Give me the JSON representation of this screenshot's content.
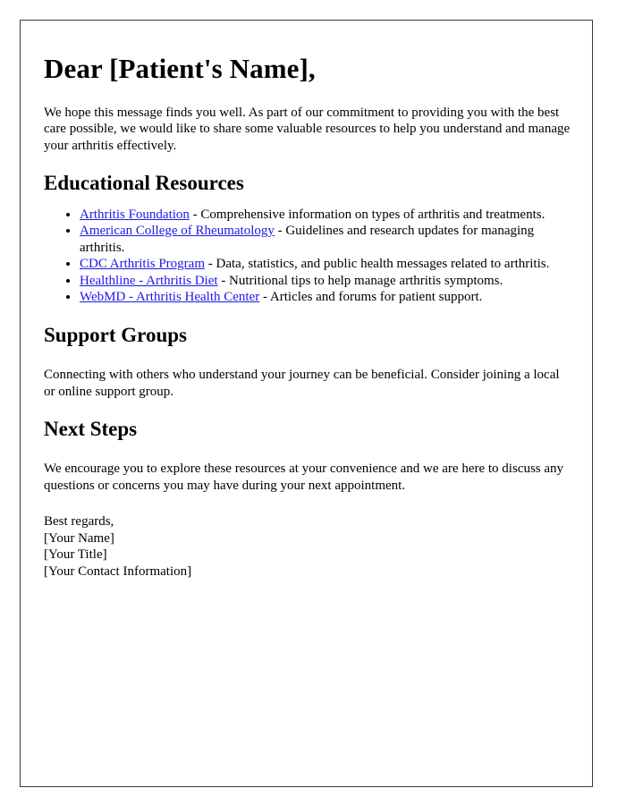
{
  "document": {
    "salutation": "Dear [Patient's Name],",
    "intro_paragraph": "We hope this message finds you well. As part of our commitment to providing you with the best care possible, we would like to share some valuable resources to help you understand and manage your arthritis effectively.",
    "link_color": "#1a1ae6",
    "sections": {
      "educational_resources": {
        "heading": "Educational Resources",
        "items": [
          {
            "link_text": "Arthritis Foundation",
            "description": " - Comprehensive information on types of arthritis and treatments."
          },
          {
            "link_text": "American College of Rheumatology",
            "description": " - Guidelines and research updates for managing arthritis."
          },
          {
            "link_text": "CDC Arthritis Program",
            "description": " - Data, statistics, and public health messages related to arthritis."
          },
          {
            "link_text": "Healthline - Arthritis Diet",
            "description": " - Nutritional tips to help manage arthritis symptoms."
          },
          {
            "link_text": "WebMD - Arthritis Health Center",
            "description": " - Articles and forums for patient support."
          }
        ]
      },
      "support_groups": {
        "heading": "Support Groups",
        "paragraph": "Connecting with others who understand your journey can be beneficial. Consider joining a local or online support group."
      },
      "next_steps": {
        "heading": "Next Steps",
        "paragraph": "We encourage you to explore these resources at your convenience and we are here to discuss any questions or concerns you may have during your next appointment."
      }
    },
    "closing": {
      "regards": "Best regards,",
      "name": "[Your Name]",
      "title": "[Your Title]",
      "contact": "[Your Contact Information]"
    }
  }
}
